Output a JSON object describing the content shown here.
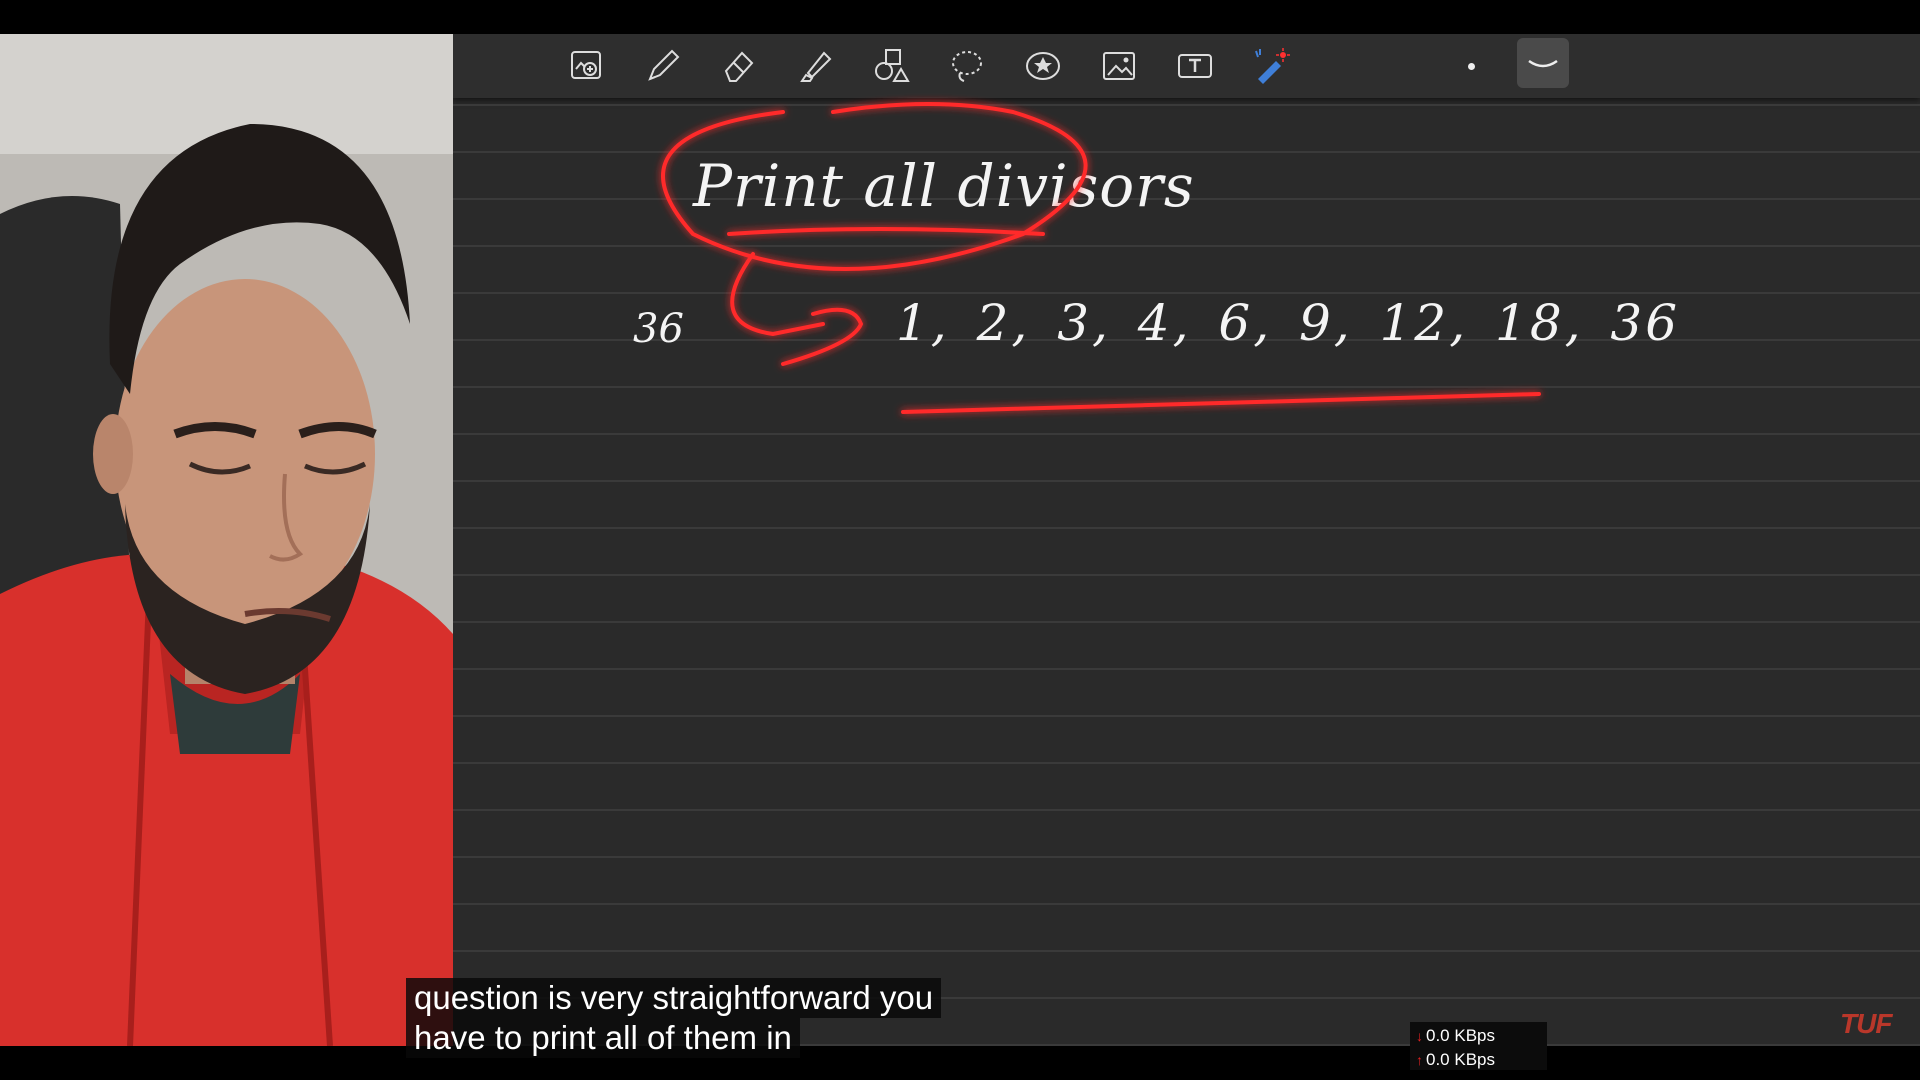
{
  "toolbar": {
    "tools": [
      {
        "icon": "image-zoom-icon"
      },
      {
        "icon": "pen-icon"
      },
      {
        "icon": "eraser-icon"
      },
      {
        "icon": "highlighter-icon"
      },
      {
        "icon": "shapes-icon"
      },
      {
        "icon": "lasso-icon"
      },
      {
        "icon": "sticker-icon"
      },
      {
        "icon": "image-icon"
      },
      {
        "icon": "text-box-icon"
      },
      {
        "icon": "laser-pointer-icon"
      }
    ],
    "pen_size_icon": "dot-icon",
    "stroke_style_icon": "curve-stroke-icon"
  },
  "note": {
    "title": "Print all divisors",
    "number": "36",
    "divisors": "1, 2, 3, 4, 6, 9, 12, 18, 36"
  },
  "captions": {
    "line1": "question is very straightforward you",
    "line2": "have to print all of them in"
  },
  "netmeter": {
    "down": "0.0 KBps",
    "up": "0.0 KBps"
  },
  "watermark": "TUF",
  "colors": {
    "ink": "#f4f4f4",
    "annotation": "#ff2a2a",
    "hoodie": "#d8302c",
    "canvas": "#2a2a2a"
  }
}
